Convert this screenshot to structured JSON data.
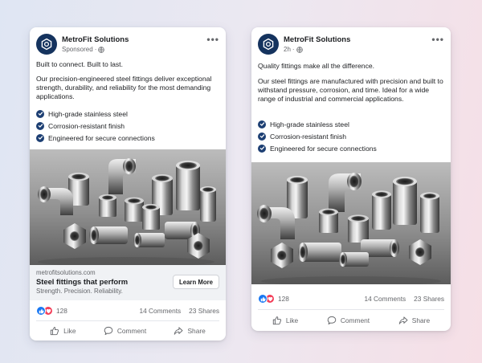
{
  "colors": {
    "brand_navy": "#15335e",
    "check_blue": "#1d3f73",
    "like_blue": "#1877f2",
    "love_red": "#f33e58"
  },
  "posts": [
    {
      "page_name": "MetroFit Solutions",
      "meta_label": "Sponsored",
      "headline": "Built to connect. Built to last.",
      "body": "Our precision-engineered steel fittings deliver exceptional strength, durability, and reliability for the most demanding applications.",
      "bullets": [
        "High-grade stainless steel",
        "Corrosion-resistant finish",
        "Engineered for secure connections"
      ],
      "link": {
        "domain": "metrofitsolutions.com",
        "title": "Steel fittings that perform",
        "subtitle": "Strength. Precision. Reliability.",
        "cta": "Learn More"
      },
      "reaction_count": "128",
      "comments": "14 Comments",
      "shares": "23 Shares",
      "actions": {
        "like": "Like",
        "comment": "Comment",
        "share": "Share"
      }
    },
    {
      "page_name": "MetroFit Solutions",
      "meta_label": "2h",
      "headline": "Quality fittings make all the difference.",
      "body": "Our steel fittings are manufactured with precision and built to withstand pressure, corrosion, and time. Ideal for a wide range of industrial and commercial applications.",
      "bullets": [
        "High-grade stainless steel",
        "Corrosion-resistant finish",
        "Engineered for secure connections"
      ],
      "reaction_count": "128",
      "comments": "14 Comments",
      "shares": "23 Shares",
      "actions": {
        "like": "Like",
        "comment": "Comment",
        "share": "Share"
      }
    }
  ]
}
